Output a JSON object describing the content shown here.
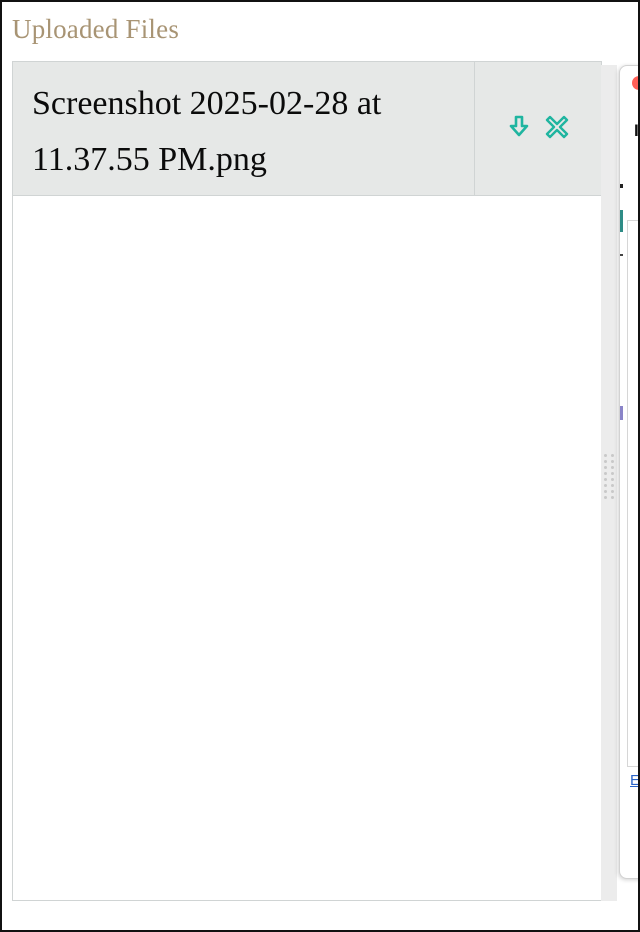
{
  "section": {
    "title": "Uploaded Files"
  },
  "files": [
    {
      "name": "Screenshot 2025-02-28 at 11.37.55 PM.png",
      "actions": {
        "download_icon": "download-arrow-icon",
        "remove_icon": "remove-x-icon"
      }
    }
  ],
  "side_window": {
    "visible_letter": "I",
    "visible_link_text": "E"
  },
  "colors": {
    "title": "#a89474",
    "row_background": "#e6e8e7",
    "action_accent": "#1fb5a0",
    "close_dot": "#ff5f57",
    "link": "#2a63c8"
  }
}
